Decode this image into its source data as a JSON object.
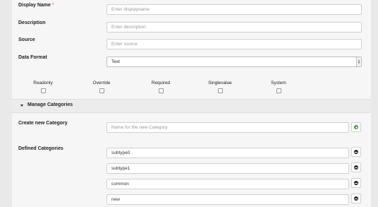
{
  "form": {
    "display_name": {
      "label": "Display Name",
      "required_mark": "*",
      "placeholder": "Enter displayname"
    },
    "description": {
      "label": "Description",
      "placeholder": "Enter description"
    },
    "source": {
      "label": "Source",
      "placeholder": "Enter source"
    },
    "data_format": {
      "label": "Data Format",
      "value": "Text"
    }
  },
  "flags": [
    {
      "label": "Readonly",
      "checked": false
    },
    {
      "label": "Override",
      "checked": false
    },
    {
      "label": "Required",
      "checked": false
    },
    {
      "label": "Singlevalue",
      "checked": false
    },
    {
      "label": "System",
      "checked": false
    }
  ],
  "categories": {
    "header": "Manage Categories",
    "create_label": "Create new Category",
    "create_placeholder": "Name for the new Category",
    "defined_label": "Defined Categories",
    "items": [
      {
        "value": "subtype0"
      },
      {
        "value": "subtype1"
      },
      {
        "value": "common"
      },
      {
        "value": "new"
      }
    ]
  },
  "colors": {
    "add": "#3c9c3c",
    "remove": "#222222",
    "required": "#d9534f"
  },
  "icons": {
    "add": "plus-circle-icon",
    "remove": "minus-circle-icon",
    "collapse": "caret-down-icon"
  }
}
